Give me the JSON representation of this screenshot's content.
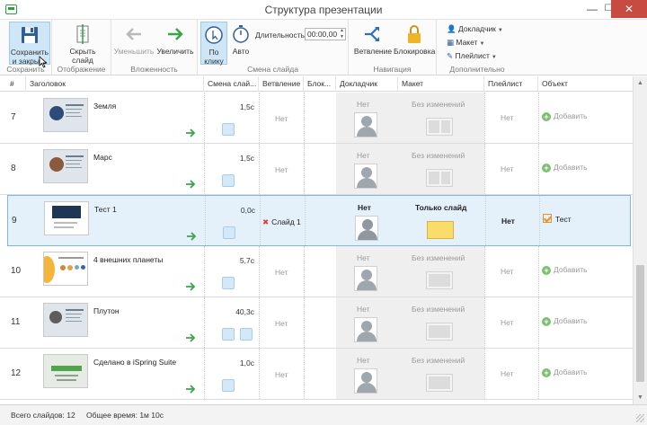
{
  "window": {
    "title": "Структура презентации",
    "minimize": "—",
    "maximize": "☐",
    "close": "✕"
  },
  "ribbon": {
    "groups": {
      "save": {
        "label": "Сохранить",
        "button": "Сохранить и закрыть"
      },
      "display": {
        "label": "Отображение",
        "button": "Скрыть слайд"
      },
      "nesting": {
        "label": "Вложенность",
        "decrease": "Уменьшить",
        "increase": "Увеличить"
      },
      "slide_change": {
        "label": "Смена слайда",
        "on_click": "По клику",
        "auto": "Авто",
        "duration_label": "Длительность:",
        "duration_value": "00:00,00"
      },
      "navigation": {
        "label": "Навигация",
        "branching": "Ветвление",
        "lock": "Блокировка"
      },
      "extra": {
        "label": "Дополнительно",
        "narrator": "Докладчик",
        "layout": "Макет",
        "playlist": "Плейлист"
      }
    }
  },
  "table": {
    "columns": [
      "#",
      "Заголовок",
      "Смена слай...",
      "Ветвление",
      "Блок...",
      "Докладчик",
      "Макет",
      "Плейлист",
      "Объект"
    ],
    "rows": [
      {
        "num": "7",
        "title": "Земля",
        "time": "1,5с",
        "branch": "Нет",
        "narrator": "Нет",
        "layout": "Без изменений",
        "playlist": "Нет",
        "object": "Добавить"
      },
      {
        "num": "8",
        "title": "Марс",
        "time": "1,5с",
        "branch": "Нет",
        "narrator": "Нет",
        "layout": "Без изменений",
        "playlist": "Нет",
        "object": "Добавить"
      },
      {
        "num": "9",
        "title": "Тест 1",
        "time": "0,0с",
        "branch": "Слайд 1",
        "narrator": "Нет",
        "layout": "Только слайд",
        "playlist": "Нет",
        "object": "Тест"
      },
      {
        "num": "10",
        "title": "4 внешних планеты",
        "time": "5,7с",
        "branch": "Нет",
        "narrator": "Нет",
        "layout": "Без изменений",
        "playlist": "Нет",
        "object": "Добавить"
      },
      {
        "num": "11",
        "title": "Плутон",
        "time": "40,3с",
        "branch": "Нет",
        "narrator": "Нет",
        "layout": "Без изменений",
        "playlist": "Нет",
        "object": "Добавить"
      },
      {
        "num": "12",
        "title": "Сделано в iSpring Suite",
        "time": "1,0с",
        "branch": "Нет",
        "narrator": "Нет",
        "layout": "Без изменений",
        "playlist": "Нет",
        "object": "Добавить"
      }
    ]
  },
  "status": {
    "total_slides": "Всего слайдов: 12",
    "total_time": "Общее время:  1м 10с"
  },
  "colors": {
    "accent": "#2e9e3e",
    "selection": "#e4f1fb",
    "selection_border": "#7fb6e3",
    "close": "#c74b40"
  }
}
